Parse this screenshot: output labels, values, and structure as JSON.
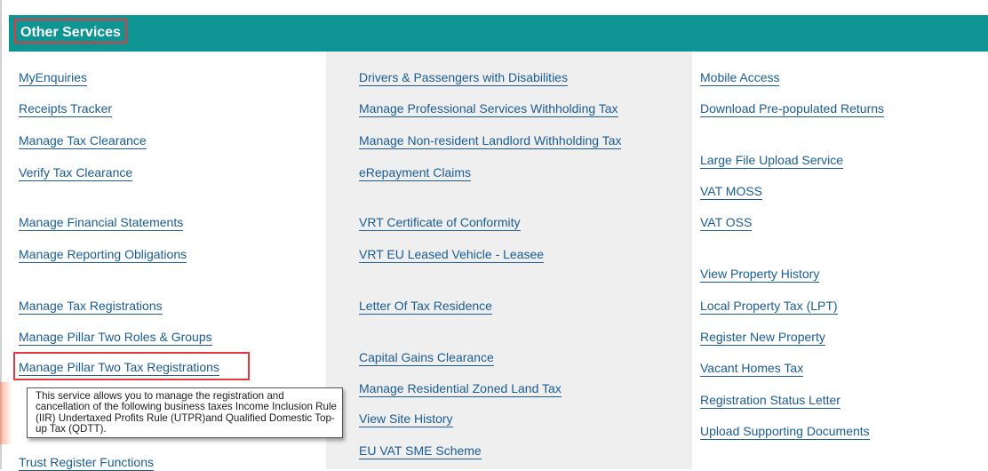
{
  "header": {
    "title": "Other Services"
  },
  "columns": [
    {
      "links": [
        "MyEnquiries",
        "Receipts Tracker",
        "Manage Tax Clearance",
        "Verify Tax Clearance",
        "Manage Financial Statements",
        "Manage Reporting Obligations",
        "Manage Tax Registrations",
        "Manage Pillar Two Roles & Groups",
        "Manage Pillar Two Tax Registrations",
        "Trust Register Functions"
      ]
    },
    {
      "links": [
        "Drivers & Passengers with Disabilities",
        "Manage Professional Services Withholding Tax",
        "Manage Non-resident Landlord Withholding Tax",
        "eRepayment Claims",
        "VRT Certificate of Conformity",
        "VRT EU Leased Vehicle - Leasee",
        "Letter Of Tax Residence",
        "Capital Gains Clearance",
        "Manage Residential Zoned Land Tax",
        "View Site History",
        "EU VAT SME Scheme"
      ]
    },
    {
      "links": [
        "Mobile Access",
        "Download Pre-populated Returns",
        "Large File Upload Service",
        "VAT MOSS",
        "VAT OSS",
        "View Property History",
        "Local Property Tax (LPT)",
        "Register New Property",
        "Vacant Homes Tax",
        "Registration Status Letter",
        "Upload Supporting Documents"
      ]
    }
  ],
  "tooltip": {
    "text": "This service allows you to manage the registration and cancellation of the following business taxes Income Inclusion Rule (IIR) Undertaxed Profits Rule (UTPR)and Qualified Domestic Top-up Tax (QDTT)."
  },
  "colors": {
    "header": "#0e9493",
    "link": "#1a5c93",
    "highlight": "#e03a3e",
    "column_alt": "#efefef"
  }
}
